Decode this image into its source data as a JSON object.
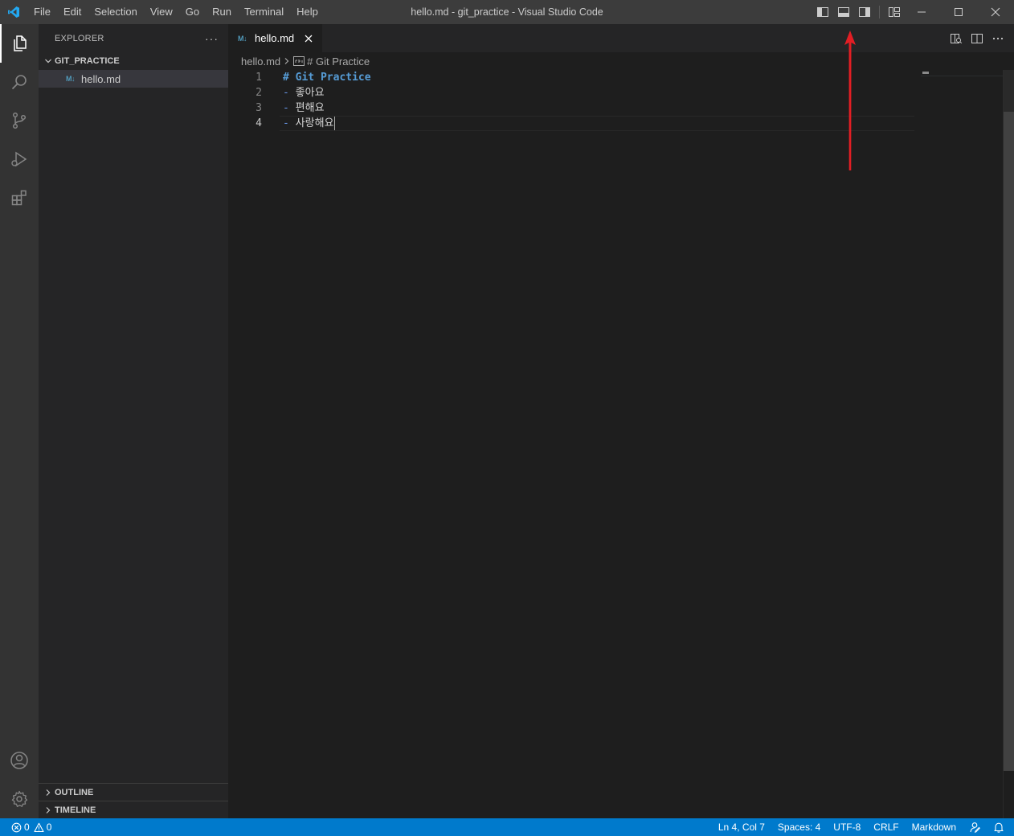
{
  "window": {
    "title": "hello.md - git_practice - Visual Studio Code",
    "menu": [
      "File",
      "Edit",
      "Selection",
      "View",
      "Go",
      "Run",
      "Terminal",
      "Help"
    ],
    "layout_controls": [
      "toggle-primary-sidebar-icon",
      "toggle-panel-icon",
      "toggle-secondary-sidebar-icon",
      "customize-layout-icon"
    ],
    "window_controls": [
      "minimize-icon",
      "maximize-icon",
      "close-icon"
    ]
  },
  "activity_bar": {
    "items": [
      "explorer-icon",
      "search-icon",
      "source-control-icon",
      "run-debug-icon",
      "extensions-icon"
    ],
    "bottom": [
      "accounts-icon",
      "manage-gear-icon"
    ]
  },
  "sidebar": {
    "title": "EXPLORER",
    "more": "···",
    "folder": "GIT_PRACTICE",
    "files": [
      {
        "icon": "M↓",
        "name": "hello.md"
      }
    ],
    "sections": [
      "OUTLINE",
      "TIMELINE"
    ]
  },
  "editor": {
    "tab": {
      "icon": "M↓",
      "label": "hello.md"
    },
    "breadcrumb": {
      "file": "hello.md",
      "symbol": "# Git Practice"
    },
    "lines": [
      {
        "num": "1",
        "dash": "",
        "text": "# Git Practice"
      },
      {
        "num": "2",
        "dash": "- ",
        "text": "좋아요"
      },
      {
        "num": "3",
        "dash": "- ",
        "text": "편해요"
      },
      {
        "num": "4",
        "dash": "- ",
        "text": "사랑해요"
      }
    ]
  },
  "status_bar": {
    "errors": "0",
    "warnings": "0",
    "position": "Ln 4, Col 7",
    "spaces": "Spaces: 4",
    "encoding": "UTF-8",
    "eol": "CRLF",
    "language": "Markdown"
  },
  "colors": {
    "accent": "#007acc",
    "annotation_arrow": "#e31e24",
    "heading": "#569cd6"
  }
}
